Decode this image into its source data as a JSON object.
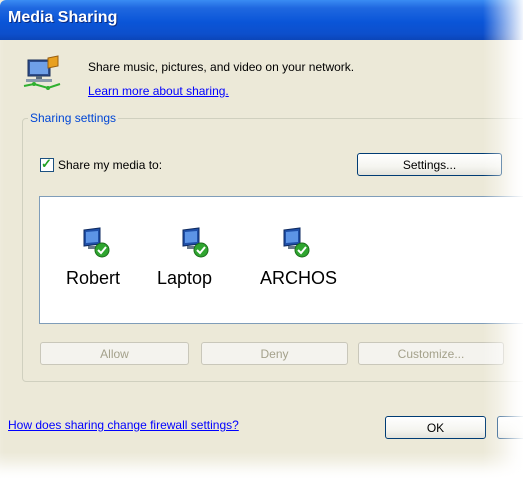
{
  "window": {
    "title": "Media Sharing"
  },
  "header": {
    "description": "Share music, pictures, and video on your network.",
    "learn_more": "Learn more about sharing."
  },
  "sharing": {
    "group_label": "Sharing settings",
    "share_checkbox_label": "Share my media to:",
    "share_checked": true,
    "settings_button": "Settings...",
    "devices": [
      {
        "name": "Robert",
        "icon": "network-computer-check-icon"
      },
      {
        "name": "Laptop",
        "icon": "network-computer-check-icon"
      },
      {
        "name": "ARCHOS",
        "icon": "network-computer-check-icon"
      }
    ],
    "allow_button": "Allow",
    "deny_button": "Deny",
    "customize_button": "Customize..."
  },
  "footer": {
    "firewall_link": "How does sharing change firewall settings?",
    "ok_button": "OK"
  }
}
